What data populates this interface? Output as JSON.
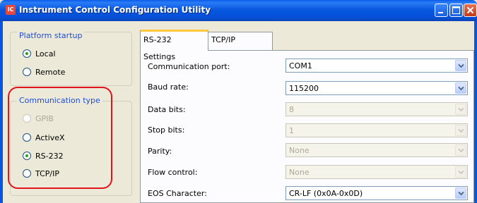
{
  "window": {
    "title": "Instrument Control Configuration Utility",
    "icon_text": "IC"
  },
  "platform_startup": {
    "legend": "Platform startup",
    "options": [
      {
        "label": "Local",
        "checked": true
      },
      {
        "label": "Remote",
        "checked": false
      }
    ]
  },
  "communication_type": {
    "legend": "Communication type",
    "options": [
      {
        "label": "GPIB",
        "checked": false,
        "disabled": true
      },
      {
        "label": "ActiveX",
        "checked": false
      },
      {
        "label": "RS-232",
        "checked": true
      },
      {
        "label": "TCP/IP",
        "checked": false
      }
    ]
  },
  "tabs": [
    {
      "label": "RS-232 Settings",
      "active": true
    },
    {
      "label": "TCP/IP Settings",
      "active": false
    }
  ],
  "rs232_settings": {
    "fields": [
      {
        "label": "Communication port:",
        "value": "COM1",
        "enabled": true
      },
      {
        "label": "Baud rate:",
        "value": "115200",
        "enabled": true
      },
      {
        "label": "Data bits:",
        "value": "8",
        "enabled": false
      },
      {
        "label": "Stop bits:",
        "value": "1",
        "enabled": false
      },
      {
        "label": "Parity:",
        "value": "None",
        "enabled": false
      },
      {
        "label": "Flow control:",
        "value": "None",
        "enabled": false
      },
      {
        "label": "EOS Character:",
        "value": "CR-LF (0x0A-0x0D)",
        "enabled": true
      }
    ]
  },
  "colors": {
    "title_bar": "#0a58e0",
    "group_legend": "#1f4ed6",
    "highlight_outline": "#e0141a",
    "active_tab_accent": "#ffc83c",
    "selected_radio_dot": "#21a121"
  }
}
